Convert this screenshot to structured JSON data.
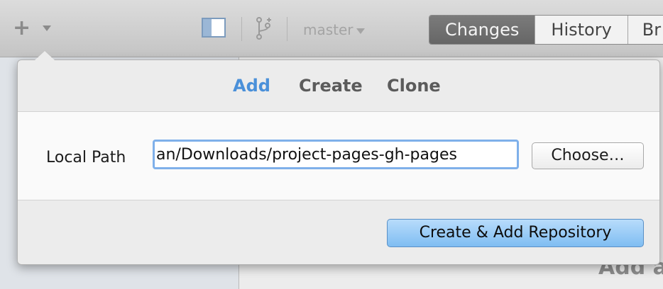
{
  "toolbar": {
    "branch": "master",
    "segments": [
      "Changes",
      "History",
      "Br"
    ]
  },
  "background": {
    "main_text": "Add a"
  },
  "popover": {
    "tabs": [
      "Add",
      "Create",
      "Clone"
    ],
    "active_tab": "Add",
    "local_path_label": "Local Path",
    "local_path_value": "an/Downloads/project-pages-gh-pages",
    "choose_label": "Choose…",
    "create_label": "Create & Add Repository"
  },
  "colors": {
    "accent": "#4a90d9",
    "focus_ring": "#7fb0ea",
    "primary_button": "#7fbdf2"
  }
}
